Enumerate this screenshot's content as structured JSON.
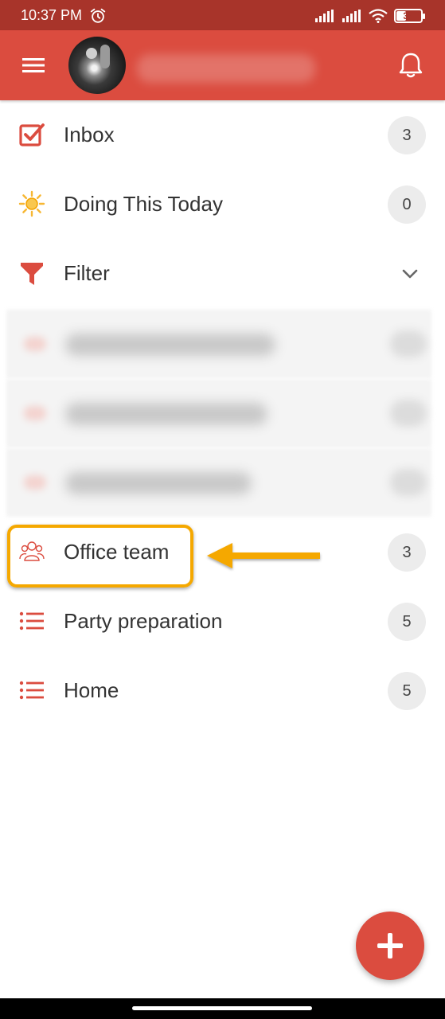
{
  "status_bar": {
    "time": "10:37 PM",
    "battery": "39",
    "battery_level": 0.39,
    "icons": [
      "alarm-icon",
      "signal-icon",
      "signal-icon",
      "wifi-icon",
      "battery-icon"
    ]
  },
  "app_bar": {
    "menu_icon": "menu-icon",
    "notification_icon": "bell-icon",
    "color": "#db4c3f"
  },
  "nav": {
    "inbox": {
      "label": "Inbox",
      "count": "3",
      "icon": "inbox-check-icon"
    },
    "today": {
      "label": "Doing This Today",
      "count": "0",
      "icon": "sun-icon"
    },
    "filter": {
      "label": "Filter",
      "icon": "filter-icon",
      "expand_icon": "chevron-down-icon"
    },
    "projects": [
      {
        "label": "Office team",
        "count": "3",
        "icon": "people-icon"
      },
      {
        "label": "Party preparation",
        "count": "5",
        "icon": "list-icon"
      },
      {
        "label": "Home",
        "count": "5",
        "icon": "list-icon"
      }
    ]
  },
  "fab": {
    "icon": "plus-icon"
  },
  "colors": {
    "accent": "#db4c3f",
    "status_bar": "#a8342a",
    "highlight": "#f5a800",
    "badge": "#ececec"
  }
}
